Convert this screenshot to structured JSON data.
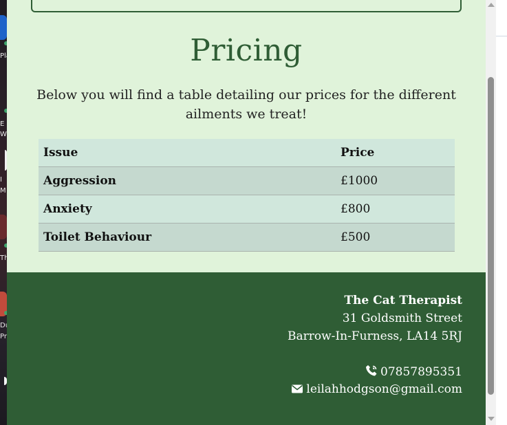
{
  "desktop": {
    "labels": [
      "Pla",
      "E",
      "W",
      "I",
      "M",
      "Th",
      "Du",
      "Pri"
    ],
    "accent": "#3ea36b"
  },
  "pricing": {
    "title": "Pricing",
    "intro": "Below you will find a table detailing our prices for the different ailments we treat!",
    "table": {
      "headers": [
        "Issue",
        "Price"
      ],
      "rows": [
        {
          "issue": "Aggression",
          "price": "£1000"
        },
        {
          "issue": "Anxiety",
          "price": "£800"
        },
        {
          "issue": "Toilet Behaviour",
          "price": "£500"
        }
      ]
    }
  },
  "footer": {
    "name": "The Cat Therapist",
    "address_line1": "31 Goldsmith Street",
    "address_line2": "Barrow-In-Furness, LA14 5RJ",
    "phone": "07857895351",
    "email": "leilahhodgson@gmail.com",
    "phone_icon": "phone-volume-icon",
    "email_icon": "envelope-icon"
  },
  "colors": {
    "page_bg": "#e0f3da",
    "brand_green": "#2f5d35",
    "table_row_light": "#d0e7dc",
    "table_row_dark": "#c5d9cf"
  }
}
